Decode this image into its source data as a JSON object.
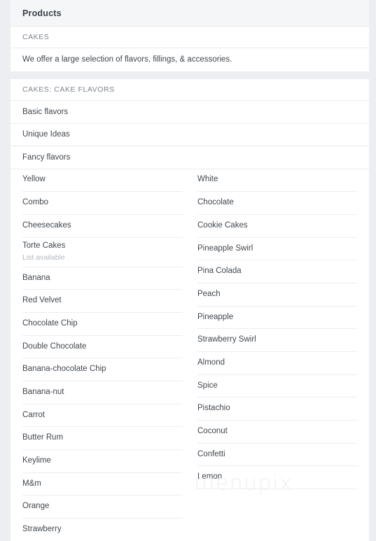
{
  "header": {
    "title": "Products"
  },
  "sections": [
    {
      "heading": "CAKES",
      "description": "We offer a large selection of flavors, fillings, & accessories."
    },
    {
      "heading": "CAKES: CAKE FLAVORS"
    }
  ],
  "full_rows": [
    {
      "name": "Basic flavors"
    },
    {
      "name": "Unique Ideas"
    },
    {
      "name": "Fancy flavors"
    }
  ],
  "columns": {
    "left": [
      {
        "name": "Yellow"
      },
      {
        "name": "Combo"
      },
      {
        "name": "Cheesecakes"
      },
      {
        "name": "Torte Cakes",
        "sub": "List available"
      },
      {
        "name": "Banana"
      },
      {
        "name": "Red Velvet"
      },
      {
        "name": "Chocolate Chip"
      },
      {
        "name": "Double Chocolate"
      },
      {
        "name": "Banana-chocolate Chip"
      },
      {
        "name": "Banana-nut"
      },
      {
        "name": "Carrot"
      },
      {
        "name": "Butter Rum"
      },
      {
        "name": "Keylime"
      },
      {
        "name": "M&m"
      },
      {
        "name": "Orange"
      },
      {
        "name": "Strawberry"
      }
    ],
    "right": [
      {
        "name": "White"
      },
      {
        "name": "Chocolate"
      },
      {
        "name": "Cookie Cakes"
      },
      {
        "name": "Pineapple Swirl"
      },
      {
        "name": "Pina Colada"
      },
      {
        "name": "Peach"
      },
      {
        "name": "Pineapple"
      },
      {
        "name": "Strawberry Swirl"
      },
      {
        "name": "Almond"
      },
      {
        "name": "Spice"
      },
      {
        "name": "Pistachio"
      },
      {
        "name": "Coconut"
      },
      {
        "name": "Confetti"
      },
      {
        "name": "Lemon"
      }
    ]
  },
  "watermark": {
    "text": "menupix"
  },
  "colors": {
    "page_background": "#eceef1",
    "card_background": "#ffffff",
    "header_background": "#f5f6f8",
    "primary_text": "#41474e",
    "muted_text": "#7d848c",
    "sub_text": "#b2b7bd",
    "divider": "#e9ebee",
    "watermark": "#f0f0f0"
  }
}
